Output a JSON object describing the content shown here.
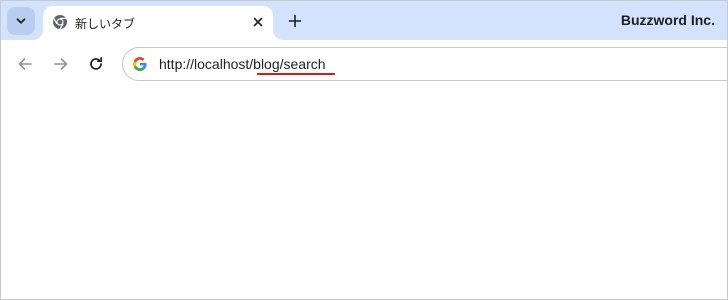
{
  "tabstrip": {
    "tab_search_icon": "chevron-down-icon",
    "tabs": [
      {
        "title": "新しいタブ",
        "favicon": "chrome-icon",
        "active": true
      }
    ],
    "new_tab_icon": "plus-icon",
    "profile_name": "Buzzword Inc."
  },
  "toolbar": {
    "back_icon": "arrow-left-icon",
    "forward_icon": "arrow-right-icon",
    "reload_icon": "reload-icon",
    "omnibox": {
      "icon": "google-g-icon",
      "url": "http://localhost/blog/search",
      "highlight_color": "#d11a1a"
    }
  },
  "colors": {
    "tabstrip_bg": "#d3e3fd",
    "text": "#1f1f1f",
    "icon": "#444746"
  }
}
